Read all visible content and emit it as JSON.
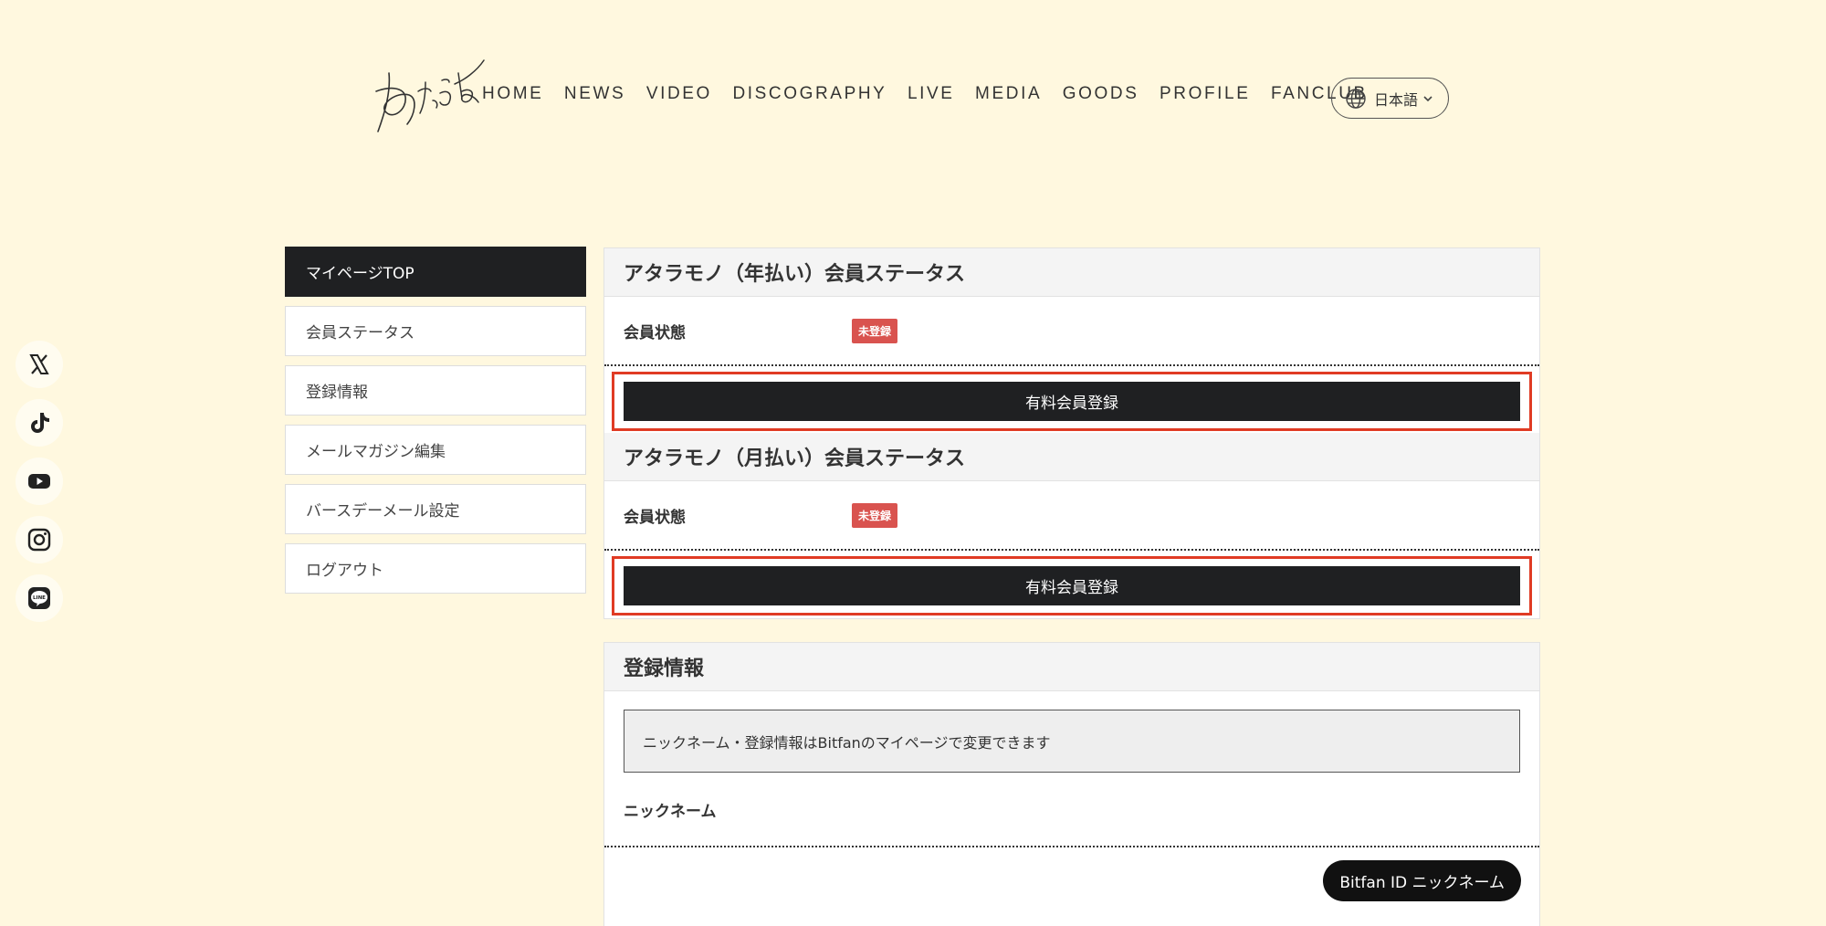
{
  "header": {
    "logo_text": "あたらよ",
    "nav": [
      "HOME",
      "NEWS",
      "VIDEO",
      "DISCOGRAPHY",
      "LIVE",
      "MEDIA",
      "GOODS",
      "PROFILE",
      "FANCLUB"
    ],
    "language": "日本語"
  },
  "social": {
    "icons": [
      "x-icon",
      "tiktok-icon",
      "youtube-icon",
      "instagram-icon",
      "line-icon"
    ]
  },
  "sidebar": {
    "items": [
      {
        "label": "マイページTOP",
        "active": true
      },
      {
        "label": "会員ステータス",
        "active": false
      },
      {
        "label": "登録情報",
        "active": false
      },
      {
        "label": "メールマガジン編集",
        "active": false
      },
      {
        "label": "バースデーメール設定",
        "active": false
      },
      {
        "label": "ログアウト",
        "active": false
      }
    ]
  },
  "status_sections": [
    {
      "title": "アタラモノ（年払い）会員ステータス",
      "label": "会員状態",
      "badge": "未登録",
      "button": "有料会員登録"
    },
    {
      "title": "アタラモノ（月払い）会員ステータス",
      "label": "会員状態",
      "badge": "未登録",
      "button": "有料会員登録"
    }
  ],
  "registration": {
    "title": "登録情報",
    "notice": "ニックネーム・登録情報はBitfanのマイページで変更できます",
    "nickname_label": "ニックネーム",
    "nickname_button": "Bitfan ID ニックネーム"
  },
  "colors": {
    "background": "#fff8df",
    "dark": "#1f2022",
    "badge": "#d9534f",
    "highlight": "#e03b24"
  }
}
